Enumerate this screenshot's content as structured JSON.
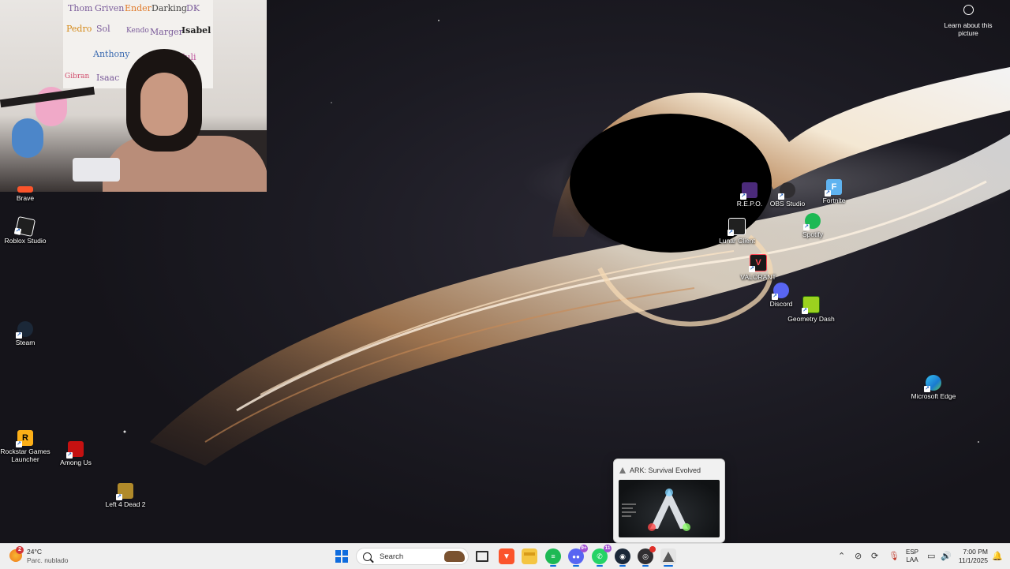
{
  "webcam": {
    "poster_names": [
      "Thom",
      "Griven",
      "Ender",
      "Darking",
      "DK",
      "Pedro",
      "Sol",
      "Kendo",
      "Marger",
      "Isabel",
      "Anthony",
      "Isaac",
      "Gibran",
      "Juli"
    ]
  },
  "desktop": {
    "learn_label": "Learn about this picture",
    "icons": [
      {
        "name": "Brave",
        "icon": "brave-icon",
        "color": "#fb542b"
      },
      {
        "name": "Roblox Studio",
        "icon": "roblox-studio-icon",
        "color": "#1f1f1f"
      },
      {
        "name": "Steam",
        "icon": "steam-icon",
        "color": "#1b2838"
      },
      {
        "name": "Rockstar Games Launcher",
        "icon": "rockstar-icon",
        "color": "#fcaf17"
      },
      {
        "name": "Among Us",
        "icon": "among-us-icon",
        "color": "#c51111"
      },
      {
        "name": "Left 4 Dead 2",
        "icon": "left4dead2-icon",
        "color": "#b08a2a"
      },
      {
        "name": "R.E.P.O.",
        "icon": "repo-icon",
        "color": "#4b2a7a"
      },
      {
        "name": "OBS Studio",
        "icon": "obs-icon",
        "color": "#302e31"
      },
      {
        "name": "Fortnite",
        "icon": "fortnite-icon",
        "color": "#5fb3f0"
      },
      {
        "name": "Lunar Client",
        "icon": "lunar-client-icon",
        "color": "#202020"
      },
      {
        "name": "Spotify",
        "icon": "spotify-icon",
        "color": "#1db954"
      },
      {
        "name": "VALORANT",
        "icon": "valorant-icon",
        "color": "#1a1a1a"
      },
      {
        "name": "Discord",
        "icon": "discord-icon",
        "color": "#5865f2"
      },
      {
        "name": "Geometry Dash",
        "icon": "geometry-dash-icon",
        "color": "#9bd21f"
      },
      {
        "name": "Microsoft Edge",
        "icon": "edge-icon",
        "color": "#1f9fd8"
      }
    ]
  },
  "preview": {
    "title": "ARK: Survival Evolved"
  },
  "taskbar": {
    "weather": {
      "temp": "24°C",
      "condition": "Parc. nublado",
      "alert_count": "2"
    },
    "search_placeholder": "Search",
    "apps": [
      {
        "name": "task-view",
        "icon": "task-view-icon",
        "color": "#2d2d2d"
      },
      {
        "name": "brave",
        "icon": "brave-icon",
        "color": "#fb542b"
      },
      {
        "name": "file-explorer",
        "icon": "folder-icon",
        "color": "#f4c542"
      },
      {
        "name": "spotify",
        "icon": "spotify-icon",
        "color": "#1db954"
      },
      {
        "name": "discord",
        "icon": "discord-icon",
        "color": "#5865f2",
        "badge": "9+"
      },
      {
        "name": "whatsapp",
        "icon": "whatsapp-icon",
        "color": "#25d366",
        "badge": "11"
      },
      {
        "name": "steam",
        "icon": "steam-icon",
        "color": "#1b2838"
      },
      {
        "name": "obs",
        "icon": "obs-icon",
        "color": "#302e31"
      },
      {
        "name": "ark",
        "icon": "ark-icon",
        "color": "#6b6b6b"
      }
    ],
    "language": {
      "line1": "ESP",
      "line2": "LAA"
    },
    "clock": {
      "time": "7:00 PM",
      "date": "11/1/2025"
    }
  },
  "colors": {
    "accent": "#0f6cde",
    "taskbar_bg": "#efefef"
  }
}
